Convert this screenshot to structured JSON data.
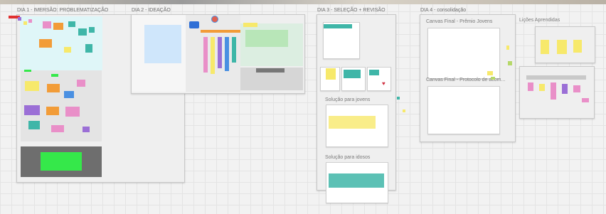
{
  "board": {
    "dia1": {
      "title": "DIA 1 - IMERSÃO: PROBLEMATIZAÇÃO"
    },
    "dia2": {
      "title": "DIA 2 - IDEAÇÃO"
    },
    "dia3": {
      "title": "DIA 3 - SELEÇÃO + REVISÃO",
      "sol_jovens": "Solução para jovens",
      "sol_idosos": "Solução para idosos"
    },
    "dia4": {
      "title": "DIA 4 - consolidação",
      "canvas_premio": "Canvas Final - Prêmio Jovens",
      "canvas_protocolo": "Canvas Final - Protocolo de acom...",
      "licoes": "Lições Aprendidas"
    }
  },
  "colors": {
    "yellow": "#f7e96b",
    "pink": "#e98fc8",
    "teal": "#3fb6a8",
    "orange": "#f29c38",
    "green": "#35e84a",
    "purple": "#9b6fd6",
    "blue": "#4a90e2"
  }
}
